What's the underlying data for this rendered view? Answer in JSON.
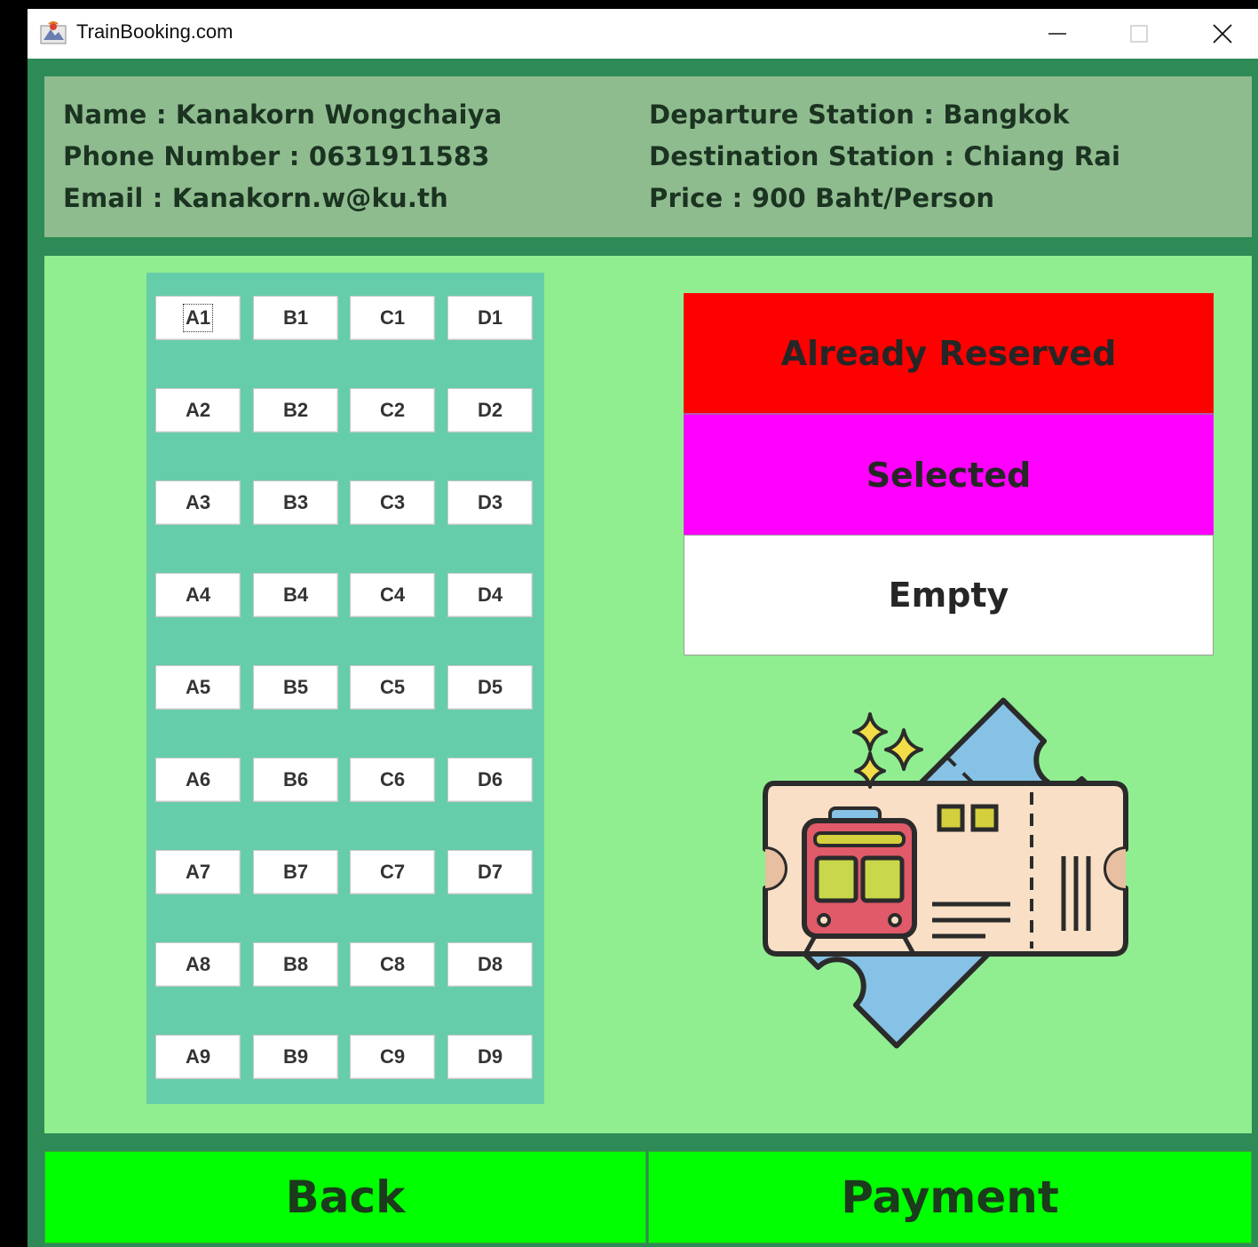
{
  "window": {
    "title": "TrainBooking.com",
    "controls": [
      "minimize",
      "maximize",
      "close"
    ]
  },
  "passenger": {
    "name": "Name : Kanakorn Wongchaiya",
    "phone": "Phone Number : 0631911583",
    "email": "Email : Kanakorn.w@ku.th"
  },
  "trip": {
    "departure": "Departure Station : Bangkok",
    "destination": "Destination Station : Chiang Rai",
    "price": "Price : 900 Baht/Person"
  },
  "seats": {
    "rows": [
      [
        "A1",
        "B1",
        "C1",
        "D1"
      ],
      [
        "A2",
        "B2",
        "C2",
        "D2"
      ],
      [
        "A3",
        "B3",
        "C3",
        "D3"
      ],
      [
        "A4",
        "B4",
        "C4",
        "D4"
      ],
      [
        "A5",
        "B5",
        "C5",
        "D5"
      ],
      [
        "A6",
        "B6",
        "C6",
        "D6"
      ],
      [
        "A7",
        "B7",
        "C7",
        "D7"
      ],
      [
        "A8",
        "B8",
        "C8",
        "D8"
      ],
      [
        "A9",
        "B9",
        "C9",
        "D9"
      ]
    ],
    "focused": "A1"
  },
  "legend": {
    "reserved": "Already Reserved",
    "selected": "Selected",
    "empty": "Empty",
    "colors": {
      "reserved": "#ff0000",
      "selected": "#ff00ff",
      "empty": "#ffffff"
    }
  },
  "illustration": "train-ticket-icon",
  "actions": {
    "back": "Back",
    "payment": "Payment"
  }
}
